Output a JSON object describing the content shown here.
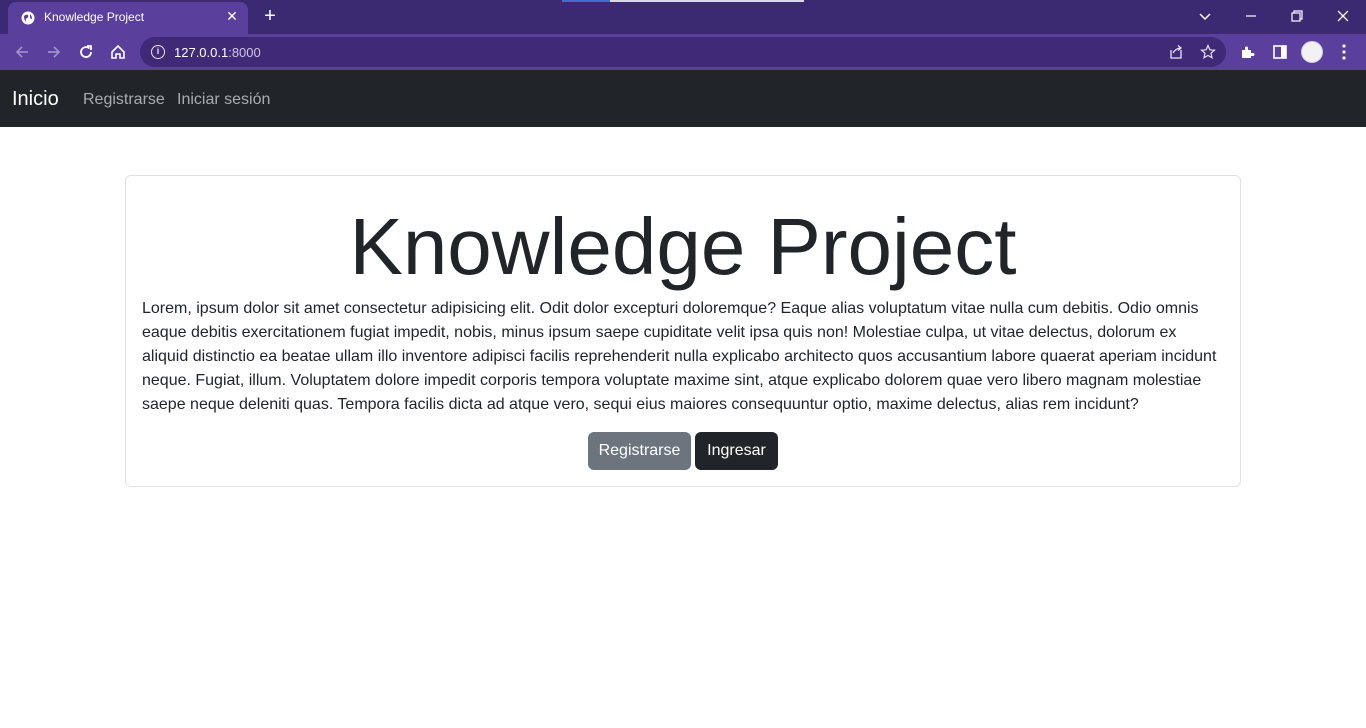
{
  "browser": {
    "tab_title": "Knowledge Project",
    "url_host": "127.0.0.1",
    "url_port": ":8000",
    "icons": {
      "favicon": "globe-icon",
      "tab_close": "close-icon",
      "new_tab": "plus-icon",
      "tab_search": "chevron-down-icon",
      "minimize": "minimize-icon",
      "restore": "restore-icon",
      "close_window": "close-icon",
      "back": "back-arrow-icon",
      "forward": "forward-arrow-icon",
      "reload": "reload-icon",
      "home": "home-icon",
      "site_info": "info-icon",
      "share": "share-icon",
      "bookmark": "star-icon",
      "extensions": "puzzle-icon",
      "side_panel": "side-panel-icon",
      "profile": "avatar",
      "menu": "kebab-menu-icon"
    },
    "colors": {
      "frame": "#3b2a72",
      "toolbar": "#5a3f9c",
      "omnibox": "#3f2a78"
    }
  },
  "navbar": {
    "brand": "Inicio",
    "links": [
      {
        "label": "Registrarse"
      },
      {
        "label": "Iniciar sesión"
      }
    ],
    "color": "#212529"
  },
  "card": {
    "title": "Knowledge Project",
    "text": "Lorem, ipsum dolor sit amet consectetur adipisicing elit. Odit dolor excepturi doloremque? Eaque alias voluptatum vitae nulla cum debitis. Odio omnis eaque debitis exercitationem fugiat impedit, nobis, minus ipsum saepe cupiditate velit ipsa quis non! Molestiae culpa, ut vitae delectus, dolorum ex aliquid distinctio ea beatae ullam illo inventore adipisci facilis reprehenderit nulla explicabo architecto quos accusantium labore quaerat aperiam incidunt neque. Fugiat, illum. Voluptatem dolore impedit corporis tempora voluptate maxime sint, atque explicabo dolorem quae vero libero magnam molestiae saepe neque deleniti quas. Tempora facilis dicta ad atque vero, sequi eius maiores consequuntur optio, maxime delectus, alias rem incidunt?",
    "buttons": {
      "register": "Registrarse",
      "login": "Ingresar"
    },
    "colors": {
      "register": "#6c757d",
      "login": "#212529"
    }
  }
}
